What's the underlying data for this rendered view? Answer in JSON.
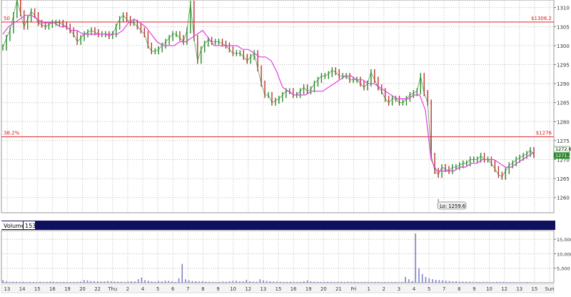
{
  "chart_data": [
    {
      "type": "line",
      "panel": "price",
      "title": "",
      "xlabel": "",
      "ylabel": "",
      "ylim": [
        1256,
        1312
      ],
      "y_ticks": [
        1260,
        1265,
        1270,
        1275,
        1280,
        1285,
        1290,
        1295,
        1300,
        1305,
        1310
      ],
      "x_tick_labels": [
        "13",
        "14",
        "15",
        "16",
        "19",
        "20",
        "22",
        "Thu",
        "2",
        "4",
        "5",
        "6",
        "7",
        "8",
        "9",
        "10",
        "12",
        "13",
        "15",
        "16",
        "19",
        "20",
        "21",
        "Fri",
        "1",
        "2",
        "3",
        "4",
        "5",
        "7",
        "8",
        "9",
        "10",
        "12",
        "13",
        "15",
        "Sun"
      ],
      "grid": true,
      "fib_levels": [
        {
          "label": "50",
          "price_label": "$1306.2",
          "value": 1306.2,
          "color": "#e02020"
        },
        {
          "label": "38.2%",
          "price_label": "$1276",
          "value": 1276.0,
          "color": "#e02020"
        }
      ],
      "last_price_labels": [
        "1272.6",
        "1271.2"
      ],
      "annotation": {
        "text": "Lo: 1259.6",
        "value": 1259.6
      },
      "series": [
        {
          "role": "price",
          "color": "#2a8a2a",
          "values": [
            1299.5,
            1302,
            1304,
            1308,
            1312,
            1308.5,
            1305,
            1307,
            1309,
            1308,
            1306,
            1305.5,
            1305,
            1305.5,
            1306,
            1306,
            1306,
            1305.5,
            1305,
            1304,
            1303,
            1301,
            1302,
            1303,
            1303.5,
            1304,
            1303.5,
            1303,
            1303,
            1303,
            1302.5,
            1303,
            1305,
            1307,
            1308,
            1307,
            1306,
            1306,
            1305,
            1304,
            1303,
            1300,
            1298.5,
            1298.5,
            1299,
            1300,
            1301,
            1302,
            1303,
            1303,
            1302,
            1301,
            1304,
            1311,
            1302,
            1296,
            1299,
            1300.5,
            1301.5,
            1301,
            1301,
            1301,
            1300.5,
            1300,
            1299,
            1298,
            1298,
            1298,
            1297,
            1296,
            1297,
            1298,
            1294,
            1290,
            1287,
            1287,
            1285,
            1285.5,
            1286,
            1287,
            1288,
            1288,
            1287,
            1287,
            1288,
            1289,
            1288,
            1288.5,
            1290,
            1291,
            1292,
            1292,
            1292.5,
            1293.5,
            1293,
            1292,
            1292,
            1292,
            1291,
            1291,
            1291,
            1290,
            1289,
            1290,
            1293,
            1291,
            1289,
            1288,
            1286,
            1285,
            1286,
            1286,
            1285,
            1285,
            1286,
            1287,
            1287.5,
            1288,
            1292,
            1287.5,
            1285,
            1271,
            1267,
            1266,
            1268,
            1267.5,
            1267,
            1268,
            1268,
            1268.5,
            1269,
            1269,
            1270,
            1270,
            1270,
            1271,
            1270,
            1270,
            1269,
            1267.5,
            1266,
            1265.5,
            1267,
            1268.5,
            1269,
            1270,
            1270.5,
            1271,
            1271.5,
            1272.5,
            1271.2
          ]
        },
        {
          "role": "moving-average",
          "color": "#e040e0",
          "values": [
            1303,
            1305,
            1306,
            1307,
            1308,
            1308,
            1307,
            1306,
            1306,
            1306,
            1305,
            1305,
            1304,
            1304,
            1303,
            1303,
            1303,
            1303,
            1303,
            1303,
            1303,
            1304,
            1306,
            1307,
            1306,
            1305,
            1303,
            1301,
            1300,
            1300,
            1300,
            1301,
            1301,
            1302,
            1303,
            1304,
            1302,
            1300,
            1300,
            1300,
            1300,
            1300,
            1299,
            1299,
            1298,
            1297,
            1297,
            1296,
            1293,
            1289,
            1288,
            1287,
            1287,
            1287,
            1288,
            1288,
            1288,
            1289,
            1290,
            1291,
            1292,
            1292,
            1291,
            1291,
            1290,
            1290,
            1289,
            1288,
            1287,
            1286,
            1286,
            1286,
            1287,
            1287,
            1283,
            1270,
            1267,
            1267,
            1267,
            1267,
            1268,
            1268,
            1269,
            1269,
            1270,
            1270,
            1270,
            1269,
            1268,
            1268,
            1269,
            1270,
            1271,
            1272
          ]
        }
      ]
    },
    {
      "type": "bar",
      "panel": "volume",
      "title": "Volume",
      "badge": "153",
      "ylim": [
        0,
        18000
      ],
      "y_ticks": [
        5000,
        10000,
        15000
      ],
      "y_tick_labels": [
        "5,000",
        "10,000",
        "15,000"
      ],
      "grid": true,
      "color": "#7d83c8",
      "values": [
        900,
        500,
        300,
        400,
        350,
        300,
        350,
        250,
        300,
        280,
        250,
        350,
        250,
        300,
        400,
        350,
        300,
        250,
        300,
        280,
        250,
        300,
        350,
        400,
        900,
        800,
        600,
        550,
        500,
        450,
        500,
        600,
        500,
        450,
        400,
        350,
        300,
        400,
        500,
        450,
        1200,
        1800,
        900,
        700,
        500,
        400,
        600,
        500,
        700,
        650,
        500,
        300,
        1500,
        6500,
        1200,
        800,
        600,
        500,
        450,
        500,
        400,
        350,
        300,
        300,
        300,
        400,
        350,
        500,
        600,
        700,
        500,
        500,
        1000,
        500,
        400,
        350,
        1200,
        800,
        600,
        500,
        400,
        400,
        350,
        300,
        300,
        350,
        300,
        300,
        300,
        500,
        800,
        500,
        350,
        300,
        300,
        300,
        350,
        300,
        280,
        300,
        350,
        300,
        350,
        300,
        300,
        300,
        300,
        300,
        300,
        300,
        300,
        300,
        250,
        250,
        250,
        300,
        300,
        300,
        300,
        2000,
        1200,
        600,
        17000,
        5000,
        3000,
        2000,
        1500,
        1200,
        1000,
        900,
        800,
        700,
        600,
        500,
        500,
        400,
        400,
        400,
        350,
        300,
        300,
        300,
        300,
        300,
        250,
        250,
        300,
        300,
        300,
        250,
        250,
        250,
        200,
        200,
        200,
        250,
        200,
        150
      ]
    }
  ]
}
